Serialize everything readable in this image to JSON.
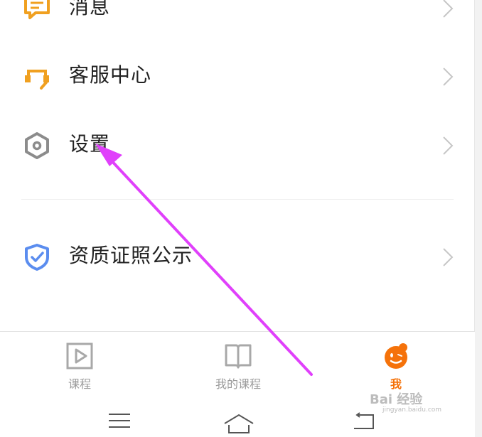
{
  "menu": {
    "messages": {
      "label": "消息",
      "icon": "message-icon"
    },
    "service": {
      "label": "客服中心",
      "icon": "headset-icon"
    },
    "settings": {
      "label": "设置",
      "icon": "settings-hexagon-icon"
    },
    "license": {
      "label": "资质证照公示",
      "icon": "shield-check-icon"
    }
  },
  "tabbar": {
    "courses": {
      "label": "课程",
      "icon": "play-icon"
    },
    "my_courses": {
      "label": "我的课程",
      "icon": "book-icon"
    },
    "me": {
      "label": "我",
      "icon": "mascot-icon"
    }
  },
  "system_nav": {
    "icons": [
      "menu-icon",
      "home-icon",
      "back-icon"
    ]
  },
  "watermark": {
    "text": "Bai 经验",
    "sub": "jingyan.baidu.com"
  },
  "colors": {
    "accent": "#f5720a",
    "annotation_arrow": "#e040fb",
    "service_icon": "#f0a020",
    "shield_icon": "#5b8def"
  }
}
